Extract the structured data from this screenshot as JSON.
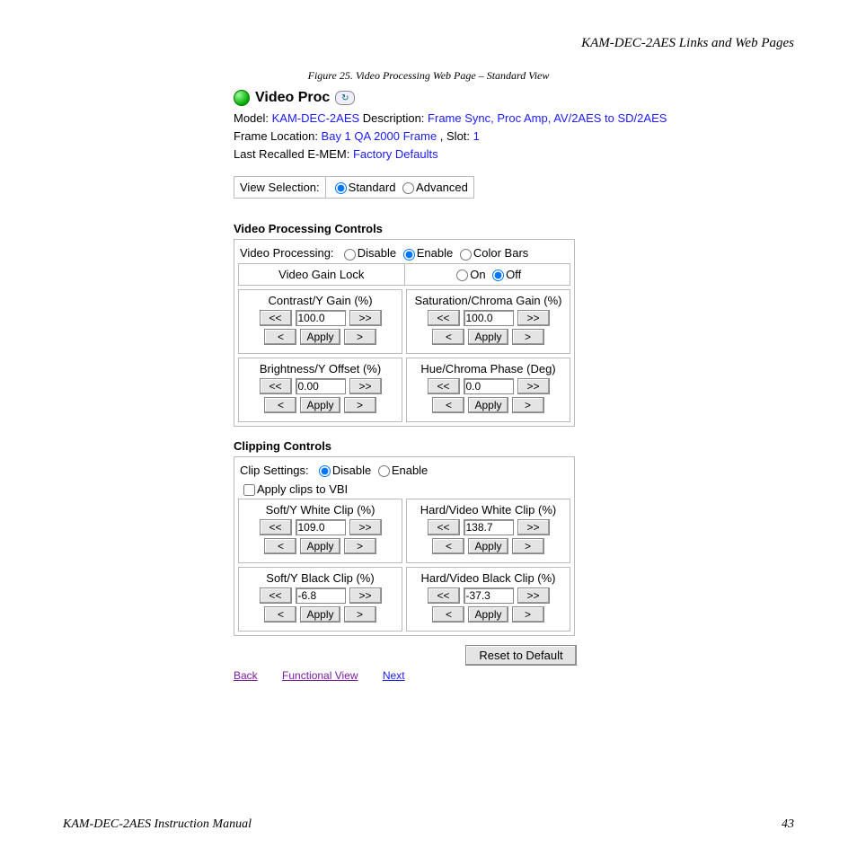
{
  "header": {
    "section": "KAM-DEC-2AES Links and Web Pages"
  },
  "figure": {
    "caption": "Figure 25.  Video Processing Web Page – Standard View"
  },
  "title": "Video Proc",
  "meta": {
    "model_label": "Model: ",
    "model": "KAM-DEC-2AES",
    "desc_label": " Description: ",
    "desc": "Frame Sync, Proc Amp, AV/2AES to SD/2AES",
    "frame_label": "Frame Location: ",
    "frame": "Bay 1 QA 2000 Frame",
    "slot_label": " , Slot: ",
    "slot": "1",
    "emem_label": "Last Recalled E-MEM: ",
    "emem": "Factory Defaults"
  },
  "view": {
    "label": "View Selection:",
    "standard": "Standard",
    "advanced": "Advanced",
    "selected": "standard"
  },
  "vpc": {
    "title": "Video Processing Controls",
    "vp_label": "Video Processing:",
    "opt_disable": "Disable",
    "opt_enable": "Enable",
    "opt_colorbars": "Color Bars",
    "gainlock_label": "Video Gain Lock",
    "on": "On",
    "off": "Off",
    "cells": {
      "contrast": {
        "label": "Contrast/Y Gain (%)",
        "value": "100.0"
      },
      "saturation": {
        "label": "Saturation/Chroma Gain (%)",
        "value": "100.0"
      },
      "brightness": {
        "label": "Brightness/Y Offset (%)",
        "value": "0.00"
      },
      "hue": {
        "label": "Hue/Chroma Phase (Deg)",
        "value": "0.0"
      }
    }
  },
  "clip": {
    "title": "Clipping Controls",
    "settings_label": "Clip Settings:",
    "opt_disable": "Disable",
    "opt_enable": "Enable",
    "vbi_label": "Apply clips to VBI",
    "cells": {
      "softwhite": {
        "label": "Soft/Y White Clip (%)",
        "value": "109.0"
      },
      "hardwhite": {
        "label": "Hard/Video White Clip (%)",
        "value": "138.7"
      },
      "softblack": {
        "label": "Soft/Y Black Clip (%)",
        "value": "-6.8"
      },
      "hardblack": {
        "label": "Hard/Video Black Clip (%)",
        "value": "-37.3"
      }
    }
  },
  "buttons": {
    "apply": "Apply",
    "dec2": "<<",
    "inc2": ">>",
    "dec1": "<",
    "inc1": ">",
    "reset": "Reset to Default"
  },
  "links": {
    "back": "Back",
    "functional": "Functional View",
    "next": "Next"
  },
  "footer": {
    "manual": "KAM-DEC-2AES Instruction Manual",
    "page": "43"
  }
}
